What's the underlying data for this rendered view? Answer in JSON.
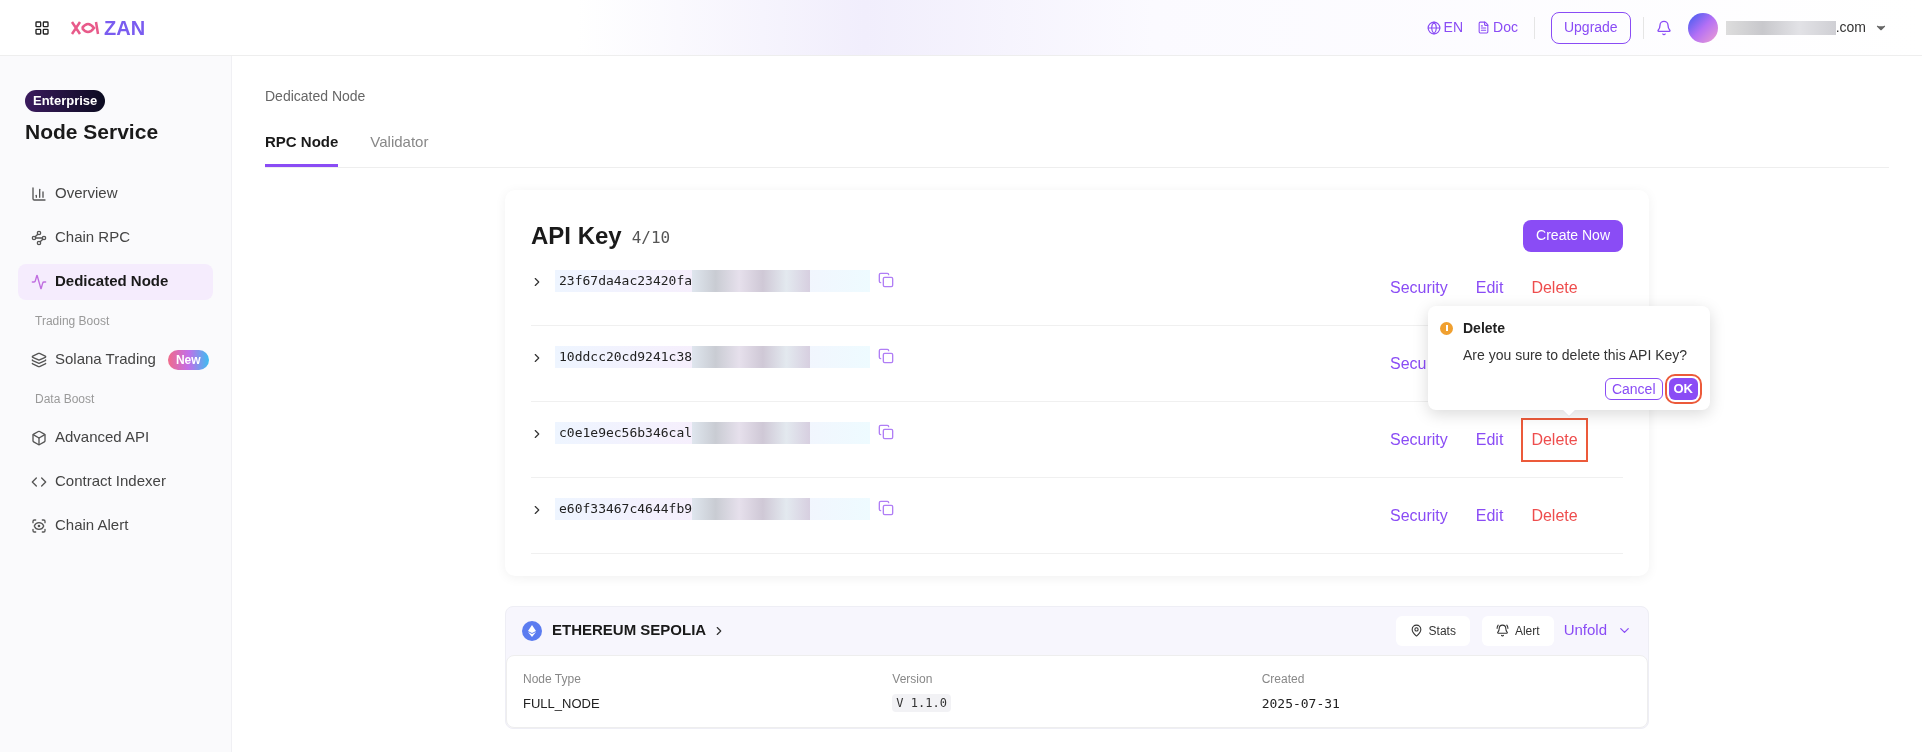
{
  "topbar": {
    "logo": "ZAN",
    "language": "EN",
    "doc": "Doc",
    "upgrade": "Upgrade",
    "account_suffix": ".com"
  },
  "sidebar": {
    "badge": "Enterprise",
    "title": "Node Service",
    "items": [
      {
        "kind": "item",
        "label": "Overview",
        "selected": false
      },
      {
        "kind": "item",
        "label": "Chain RPC",
        "selected": false
      },
      {
        "kind": "item",
        "label": "Dedicated Node",
        "selected": true
      },
      {
        "kind": "section",
        "label": "Trading Boost"
      },
      {
        "kind": "item",
        "label": "Solana Trading",
        "selected": false,
        "badge": "New"
      },
      {
        "kind": "section",
        "label": "Data Boost"
      },
      {
        "kind": "item",
        "label": "Advanced API",
        "selected": false
      },
      {
        "kind": "item",
        "label": "Contract Indexer",
        "selected": false
      },
      {
        "kind": "item",
        "label": "Chain Alert",
        "selected": false
      }
    ]
  },
  "breadcrumb": "Dedicated Node",
  "tabs": [
    {
      "label": "RPC Node",
      "selected": true
    },
    {
      "label": "Validator",
      "selected": false
    }
  ],
  "api_keys": {
    "title": "API Key",
    "count": "4/10",
    "create": "Create Now",
    "rows": [
      {
        "key": "23f67da4ac23420fa",
        "actions": [
          "Security",
          "Edit",
          "Delete"
        ],
        "delete_highlighted": false
      },
      {
        "key": "10ddcc20cd9241c38",
        "actions": [
          "Secu"
        ]
      },
      {
        "key": "c0e1e9ec56b346cal",
        "actions": [
          "Security",
          "Edit",
          "Delete"
        ],
        "delete_highlighted": true
      },
      {
        "key": "e60f33467c4644fb9",
        "actions": [
          "Security",
          "Edit",
          "Delete"
        ],
        "delete_highlighted": false
      }
    ],
    "confirm": {
      "title": "Delete",
      "message": "Are you sure to delete this API Key?",
      "cancel": "Cancel",
      "ok": "OK",
      "ok_highlighted": true
    }
  },
  "node": {
    "network": "ETHEREUM SEPOLIA",
    "stats": "Stats",
    "alert": "Alert",
    "unfold": "Unfold",
    "fields": [
      {
        "label": "Node Type",
        "value": "FULL_NODE",
        "kind": "text"
      },
      {
        "label": "Version",
        "value": "V 1.1.0",
        "kind": "tag"
      },
      {
        "label": "Created",
        "value": "2025-07-31",
        "kind": "text"
      }
    ]
  }
}
